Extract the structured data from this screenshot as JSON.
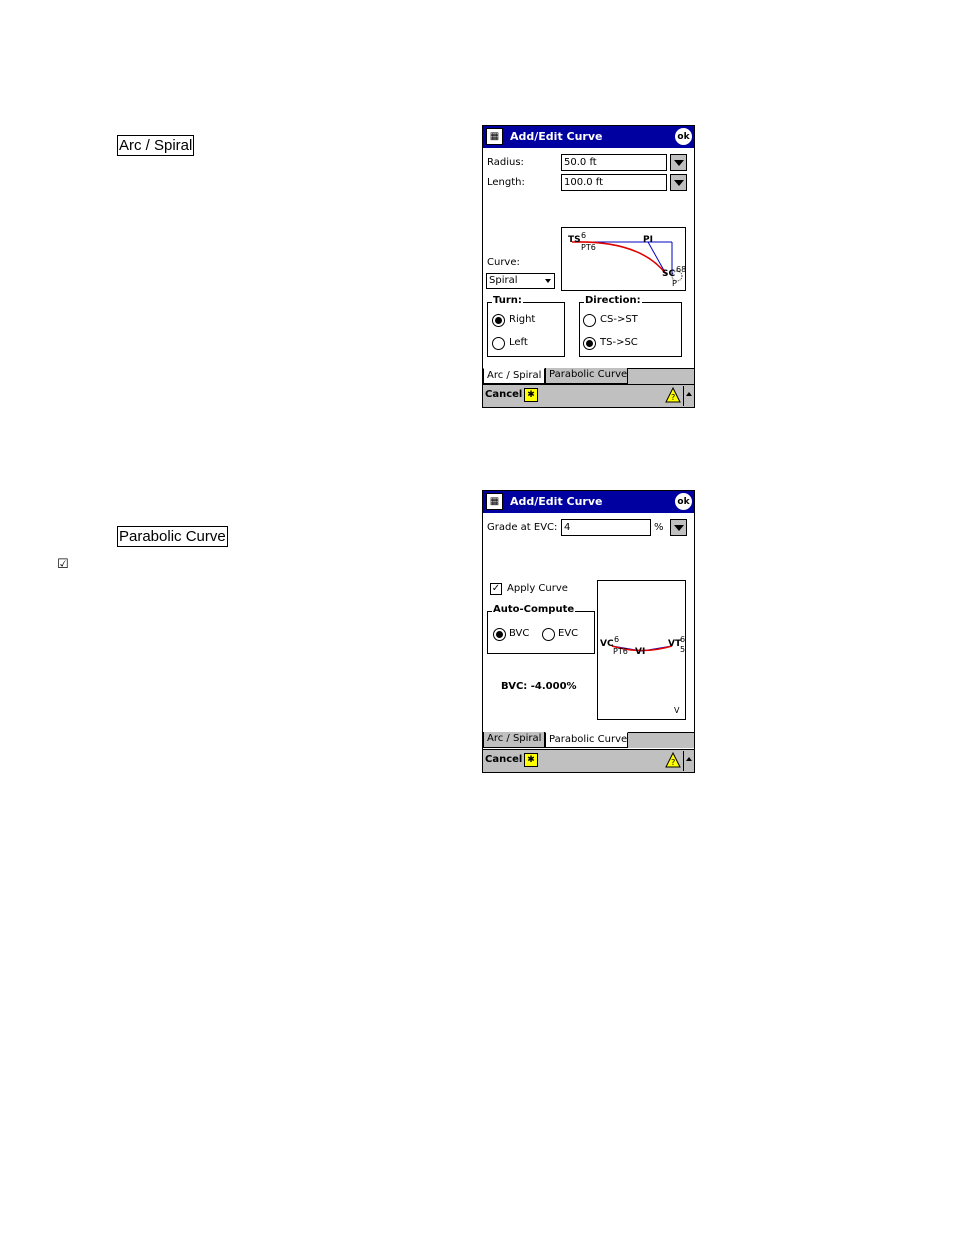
{
  "doc": {
    "label_arc": "Arc / Spiral",
    "label_parabolic": "Parabolic Curve",
    "checkbox_glyph": "☑"
  },
  "screen1": {
    "title": "Add/Edit Curve",
    "ok": "ok",
    "radius_label": "Radius:",
    "radius_value": "50.0 ft",
    "length_label": "Length:",
    "length_value": "100.0 ft",
    "curve_label": "Curve:",
    "curve_value": "Spiral",
    "diagram": {
      "ts": "TS",
      "ts_sup": "6",
      "pt": "PT6",
      "pi": "PI",
      "sc": "SC",
      "sc_sup": "68",
      "p": "P"
    },
    "turn_title": "Turn:",
    "turn_right": "Right",
    "turn_left": "Left",
    "direction_title": "Direction:",
    "dir_cs_st": "CS->ST",
    "dir_ts_sc": "TS->SC",
    "tab_arc": "Arc / Spiral",
    "tab_parabolic": "Parabolic Curve",
    "cancel": "Cancel"
  },
  "screen2": {
    "title": "Add/Edit Curve",
    "ok": "ok",
    "grade_label": "Grade at EVC:",
    "grade_value": "4",
    "percent": "%",
    "apply_label": "Apply  Curve",
    "auto_title": "Auto-Compute",
    "bvc": "BVC",
    "evc": "EVC",
    "bvc_result": "BVC: -4.000%",
    "diagram": {
      "vc": "VC",
      "vc_sup": "6",
      "pt": "PT6",
      "vi": "VI",
      "vt": "VT",
      "vt_sup": "6",
      "vt_sub": "5",
      "v": "V"
    },
    "tab_arc": "Arc / Spiral",
    "tab_parabolic": "Parabolic Curve",
    "cancel": "Cancel"
  },
  "colors": {
    "titlebar": "#0000a0",
    "curve": "#e00000",
    "tangent": "#0000c0"
  }
}
